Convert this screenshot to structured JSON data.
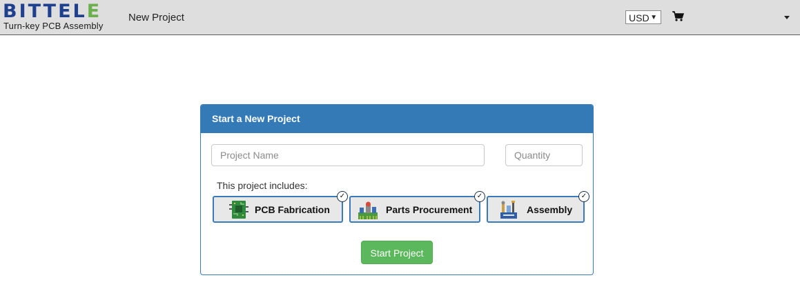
{
  "header": {
    "logo_text_blue": "BITTEL",
    "logo_text_green": "E",
    "logo_tagline": "Turn-key PCB Assembly",
    "page_title": "New Project",
    "currency": "USD",
    "cart_icon": "cart-icon",
    "menu_icon": "caret-down-icon"
  },
  "panel": {
    "title": "Start a New Project",
    "project_name_placeholder": "Project Name",
    "quantity_placeholder": "Quantity",
    "includes_label": "This project includes:",
    "options": [
      {
        "label": "PCB Fabrication",
        "icon": "pcb-icon",
        "checked": true
      },
      {
        "label": "Parts Procurement",
        "icon": "parts-icon",
        "checked": true
      },
      {
        "label": "Assembly",
        "icon": "assembly-icon",
        "checked": true
      }
    ],
    "check_mark": "✓",
    "start_button": "Start Project"
  },
  "colors": {
    "header_bg": "#dedede",
    "panel_head": "#337ab7",
    "start_button": "#5cb85c",
    "logo_blue": "#1f3f8f",
    "logo_green": "#6ab04c"
  }
}
